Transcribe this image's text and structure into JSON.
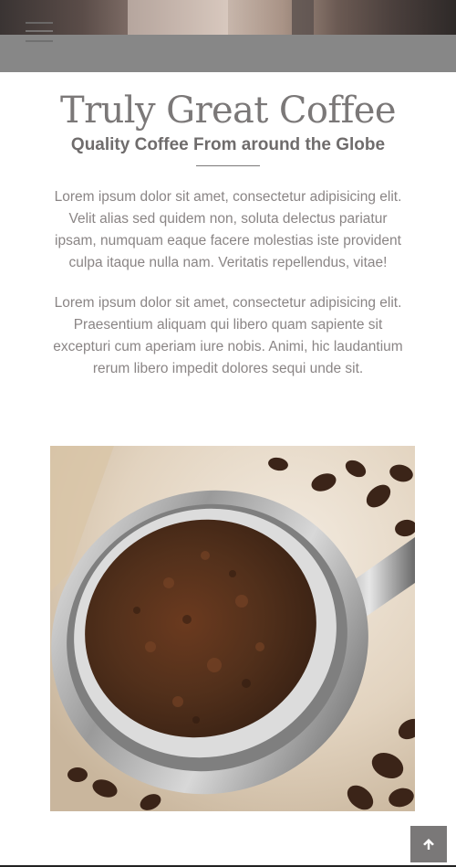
{
  "header": {
    "menu_icon": "hamburger-menu-icon"
  },
  "intro": {
    "title": "Truly Great Coffee",
    "subtitle": "Quality Coffee From around the Globe",
    "paragraphs": [
      "Lorem ipsum dolor sit amet, consectetur adipisicing elit. Velit alias sed quidem non, soluta delectus pariatur ipsam, numquam eaque facere molestias iste provident culpa itaque nulla nam. Veritatis repellendus, vitae!",
      "Lorem ipsum dolor sit amet, consectetur adipisicing elit. Praesentium aliquam qui libero quam sapiente sit excepturi cum aperiam iure nobis. Animi, hic laudantium rerum libero impedit dolores sequi unde sit."
    ]
  },
  "photo": {
    "icon": "ground-coffee-portafilter-image"
  },
  "back_to_top": {
    "icon": "arrow-up-icon"
  },
  "colors": {
    "navbar": "#878787",
    "text": "#7b7878",
    "button": "#7a7878"
  }
}
